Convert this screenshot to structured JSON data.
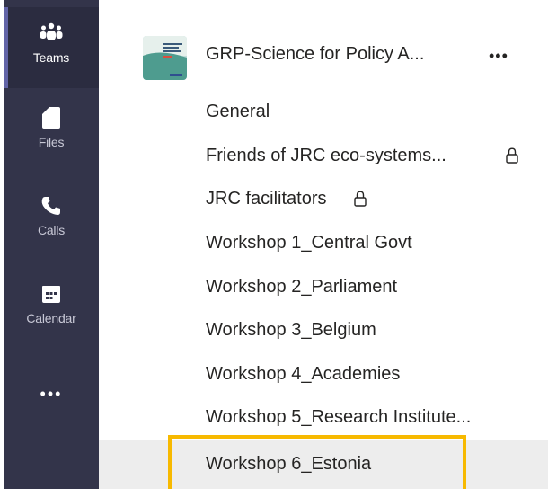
{
  "rail": {
    "items": [
      {
        "label": "Teams",
        "icon": "teams-icon"
      },
      {
        "label": "Files",
        "icon": "files-icon"
      },
      {
        "label": "Calls",
        "icon": "calls-icon"
      },
      {
        "label": "Calendar",
        "icon": "calendar-icon"
      }
    ],
    "more": "•••"
  },
  "team": {
    "name": "GRP-Science for Policy A...",
    "more": "•••"
  },
  "channels": [
    {
      "label": "General",
      "private": false
    },
    {
      "label": "Friends of JRC eco-systems...",
      "private": true
    },
    {
      "label": "JRC facilitators",
      "private": true
    },
    {
      "label": "Workshop 1_Central Govt",
      "private": false
    },
    {
      "label": "Workshop 2_Parliament",
      "private": false
    },
    {
      "label": "Workshop 3_Belgium",
      "private": false
    },
    {
      "label": "Workshop 4_Academies",
      "private": false
    },
    {
      "label": "Workshop 5_Research Institute...",
      "private": false
    },
    {
      "label": "Workshop 6_Estonia",
      "private": false
    }
  ],
  "colors": {
    "rail_bg": "#33344a",
    "accent": "#6264a7",
    "highlight": "#f7b900",
    "selected_bg": "#ededed"
  }
}
